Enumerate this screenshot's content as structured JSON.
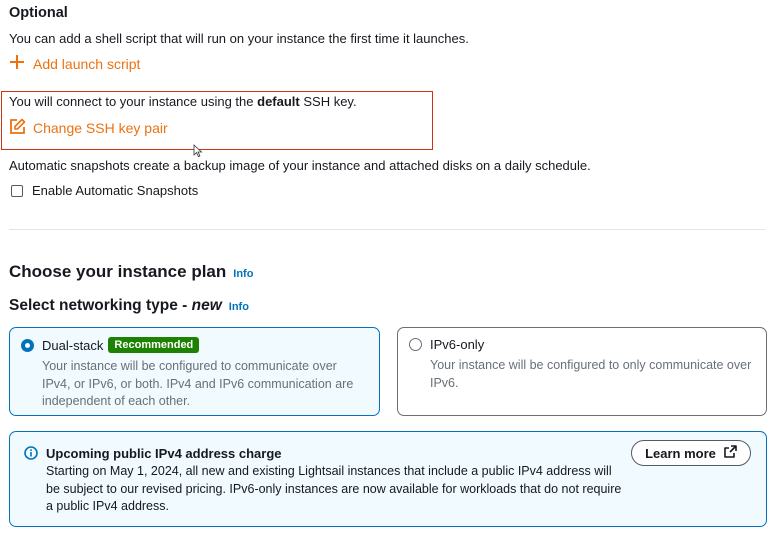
{
  "optional": {
    "heading": "Optional",
    "description": "You can add a shell script that will run on your instance the first time it launches.",
    "add_launch_script": "Add launch script"
  },
  "ssh": {
    "text_before": "You will connect to your instance using the ",
    "text_bold": "default",
    "text_after": " SSH key.",
    "change_label": "Change SSH key pair"
  },
  "snapshots": {
    "description": "Automatic snapshots create a backup image of your instance and attached disks on a daily schedule.",
    "checkbox_label": "Enable Automatic Snapshots",
    "checked": false
  },
  "plan": {
    "title": "Choose your instance plan",
    "info": "Info"
  },
  "networking": {
    "title_prefix": "Select networking type - ",
    "title_new": "new",
    "info": "Info",
    "options": [
      {
        "label": "Dual-stack",
        "badge": "Recommended",
        "selected": true,
        "description": "Your instance will be configured to communicate over IPv4, or IPv6, or both. IPv4 and IPv6 communication are independent of each other."
      },
      {
        "label": "IPv6-only",
        "selected": false,
        "description": "Your instance will be configured to only communicate over IPv6."
      }
    ]
  },
  "alert": {
    "title": "Upcoming public IPv4 address charge",
    "body": "Starting on May 1, 2024, all new and existing Lightsail instances that include a public IPv4 address will be subject to our revised pricing. IPv6-only instances are now available for workloads that do not require a public IPv4 address.",
    "button": "Learn more"
  },
  "colors": {
    "link_orange": "#ec7211",
    "highlight_red": "#d13212",
    "info_blue": "#0073bb",
    "badge_green": "#1d8102"
  }
}
